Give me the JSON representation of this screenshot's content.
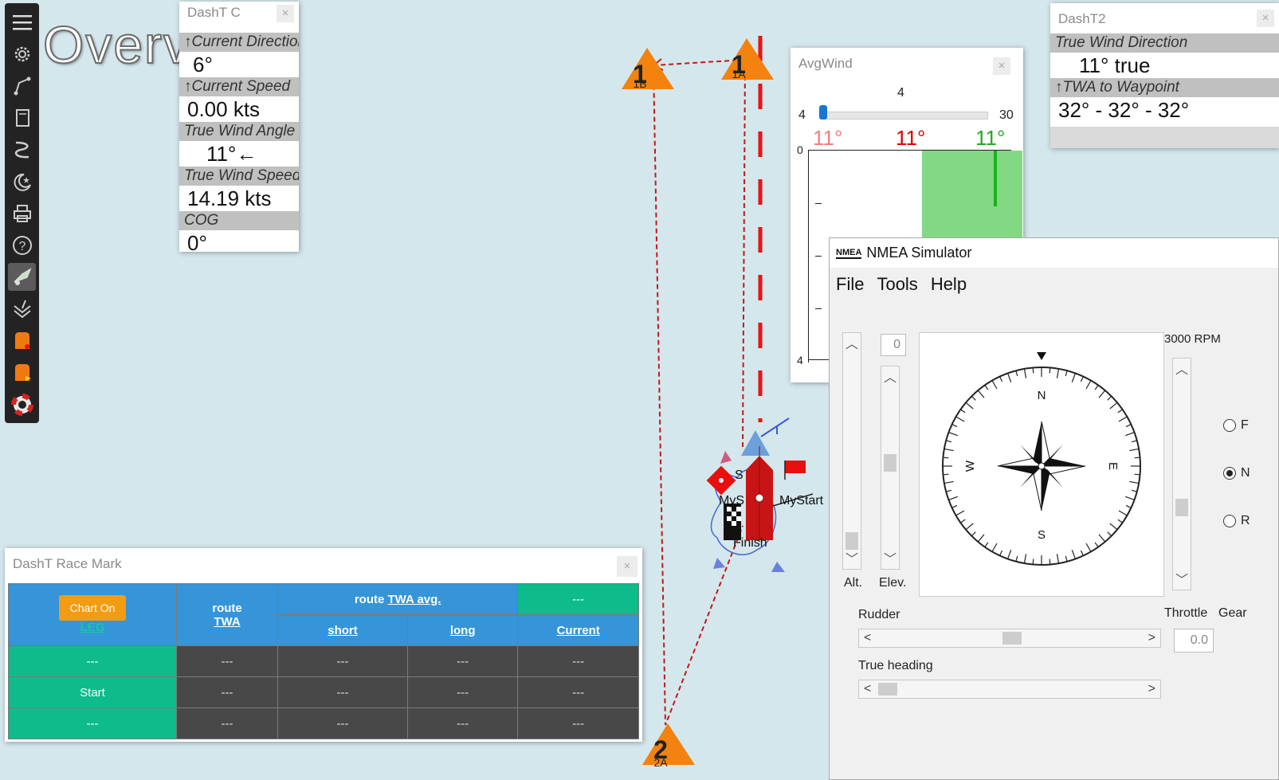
{
  "watermark": "Overview",
  "map": {
    "marks": [
      {
        "num": "1",
        "sub": "1B"
      },
      {
        "num": "1",
        "sub": "1A"
      },
      {
        "num": "2",
        "sub": "2A"
      }
    ],
    "labels": {
      "start1": "MyS",
      "start2": "MyStart",
      "finish": "Finish",
      "s": "S"
    }
  },
  "toolbar": {
    "items": [
      "menu-icon",
      "settings-icon",
      "route-icon",
      "page-icon",
      "track-icon",
      "moon-star-icon",
      "print-icon",
      "help-icon",
      "plugin-active-icon",
      "layers-icon",
      "race-start-icon",
      "race-mark-icon",
      "lifebuoy-icon"
    ]
  },
  "dasht_c": {
    "title": "DashT C",
    "close": "×",
    "rows": [
      {
        "label": "↑Current Direction",
        "value": "6°"
      },
      {
        "label": "↑Current Speed",
        "value": "0.00 kts"
      },
      {
        "label": "True Wind Angle",
        "value": "11°←"
      },
      {
        "label": "True Wind Speed",
        "value": "14.19 kts"
      },
      {
        "label": "COG",
        "value": "0°"
      }
    ]
  },
  "dasht2": {
    "title": "DashT2",
    "close": "×",
    "rows": [
      {
        "label": "True Wind Direction",
        "value": "11° true"
      },
      {
        "label": "↑TWA to Waypoint",
        "value": "32° - 32° - 32°"
      }
    ]
  },
  "avgwind": {
    "title": "AvgWind",
    "close": "×",
    "slider_value": "4",
    "slider_min": "4",
    "slider_max": "30",
    "angles": {
      "left": "11°",
      "center": "11°",
      "right": "11°"
    },
    "colors": {
      "left": "#f08080",
      "center": "#dd0000",
      "right": "#22aa22"
    },
    "axis": {
      "top": "0",
      "bottom": "4"
    }
  },
  "race_mark": {
    "title": "DashT Race Mark",
    "close": "×",
    "chart_button": "Chart On",
    "leg_link": "LEG",
    "header": {
      "route_twa_1": "route",
      "route_twa_2": "TWA",
      "twa_avg_prefix": "route ",
      "twa_avg_link": "TWA avg.",
      "top_right": "---",
      "short": "short",
      "long": "long",
      "current": "Current"
    },
    "rows": [
      [
        "---",
        "---",
        "---",
        "---",
        "---"
      ],
      [
        "Start",
        "---",
        "---",
        "---",
        "---"
      ],
      [
        "---",
        "---",
        "---",
        "---",
        "---"
      ]
    ]
  },
  "nmea": {
    "title": "NMEA Simulator",
    "menu": [
      "File",
      "Tools",
      "Help"
    ],
    "elev_value": "0",
    "alt_label": "Alt.",
    "elev_label": "Elev.",
    "rpm": "3000 RPM",
    "compass": {
      "n": "N",
      "e": "E",
      "s": "S",
      "w": "W"
    },
    "gear": [
      {
        "label": "F",
        "selected": false
      },
      {
        "label": "N",
        "selected": true
      },
      {
        "label": "R",
        "selected": false
      }
    ],
    "rudder_label": "Rudder",
    "throttle_label": "Throttle",
    "gear_label": "Gear",
    "throttle_value": "0.0",
    "heading_label": "True heading"
  }
}
